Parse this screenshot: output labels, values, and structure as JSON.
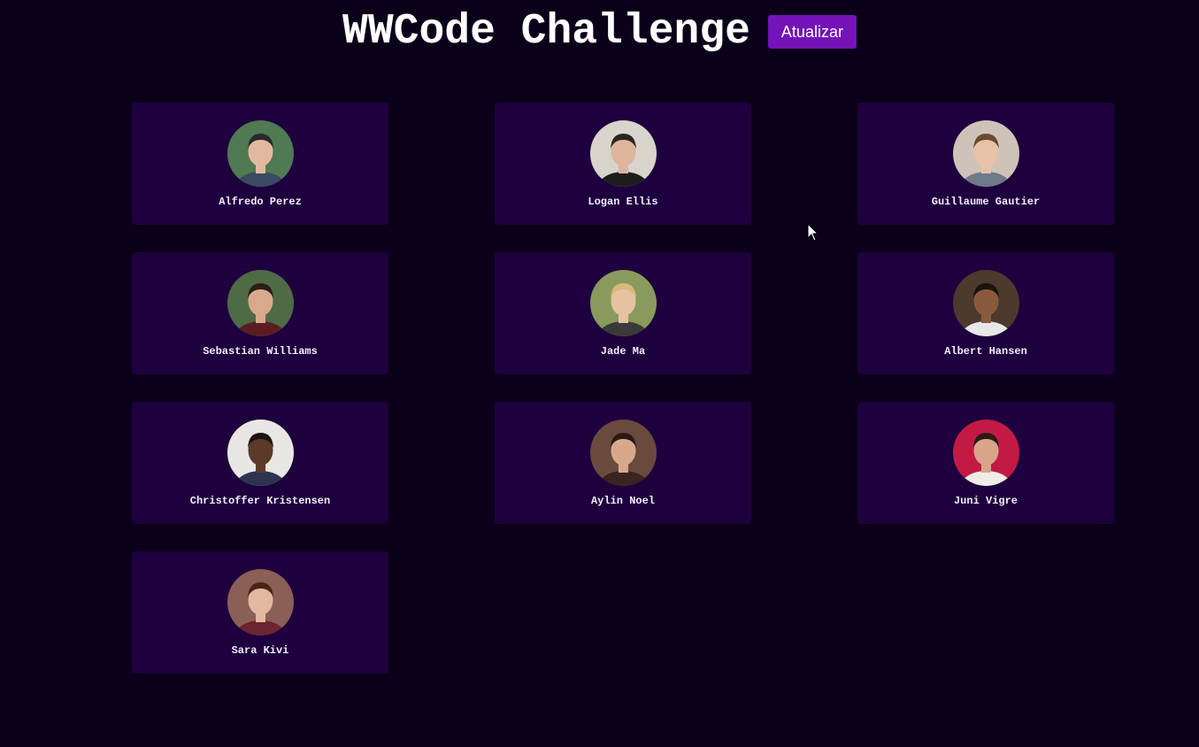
{
  "header": {
    "title": "WWCode Challenge",
    "refresh_label": "Atualizar"
  },
  "colors": {
    "background": "#0b0019",
    "card": "#1e003e",
    "button": "#7413b8"
  },
  "people": [
    {
      "name": "Alfredo Perez",
      "bg": "#4f7a52",
      "skin": "#e2b9a0",
      "hair": "#2a2a2a",
      "shirt": "#3b4a63"
    },
    {
      "name": "Logan Ellis",
      "bg": "#d8d4cc",
      "skin": "#dcb59c",
      "hair": "#2c2520",
      "shirt": "#1d1d1d"
    },
    {
      "name": "Guillaume Gautier",
      "bg": "#cfc2b8",
      "skin": "#e7c2a8",
      "hair": "#6b4a32",
      "shirt": "#6f7a8a"
    },
    {
      "name": "Sebastian Williams",
      "bg": "#4e6b45",
      "skin": "#d9a98c",
      "hair": "#2a1d16",
      "shirt": "#5a1d22"
    },
    {
      "name": "Jade Ma",
      "bg": "#8a9a5c",
      "skin": "#e6c2a2",
      "hair": "#d9b87a",
      "shirt": "#3a3a3a"
    },
    {
      "name": "Albert Hansen",
      "bg": "#4b3a2d",
      "skin": "#8a5a3c",
      "hair": "#1a1410",
      "shirt": "#e8e8e8"
    },
    {
      "name": "Christoffer Kristensen",
      "bg": "#e9e6e4",
      "skin": "#5b3a2a",
      "hair": "#1b1412",
      "shirt": "#2c3450"
    },
    {
      "name": "Aylin Noel",
      "bg": "#6a4a3d",
      "skin": "#d9a88c",
      "hair": "#2b1b16",
      "shirt": "#3a2420"
    },
    {
      "name": "Juni Vigre",
      "bg": "#c21a45",
      "skin": "#d9a58a",
      "hair": "#2a1a16",
      "shirt": "#f0ede8"
    },
    {
      "name": "Sara Kivi",
      "bg": "#8a5f55",
      "skin": "#e2b8a0",
      "hair": "#4a2418",
      "shirt": "#6a2530"
    }
  ]
}
